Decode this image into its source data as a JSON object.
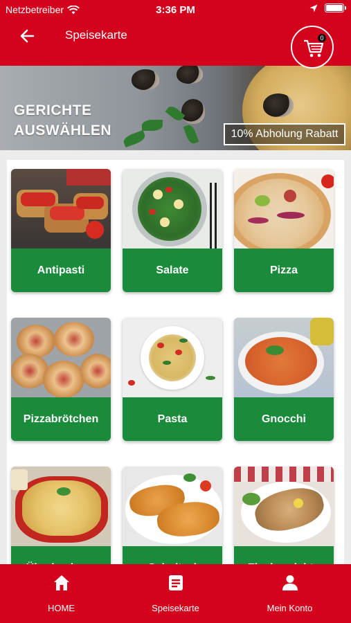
{
  "status_bar": {
    "carrier": "Netzbetreiber",
    "time": "3:36 PM"
  },
  "header": {
    "title": "Speisekarte",
    "cart_count": "0"
  },
  "banner": {
    "title_line1": "GERICHTE",
    "title_line2": "AUSWÄHLEN",
    "discount": "10% Abholung Rabatt"
  },
  "categories": [
    {
      "label": "Antipasti"
    },
    {
      "label": "Salate"
    },
    {
      "label": "Pizza"
    },
    {
      "label": "Pizzabrötchen"
    },
    {
      "label": "Pasta"
    },
    {
      "label": "Gnocchi"
    },
    {
      "label": "Überbackene"
    },
    {
      "label": "Schnitzel"
    },
    {
      "label": "Fischgerichte"
    }
  ],
  "bottom_nav": [
    {
      "label": "HOME",
      "icon": "home-icon"
    },
    {
      "label": "Speisekarte",
      "icon": "menu-list-icon"
    },
    {
      "label": "Mein Konto",
      "icon": "account-icon"
    }
  ],
  "colors": {
    "brand_red": "#d3021d",
    "category_green": "#1a8b3a"
  }
}
